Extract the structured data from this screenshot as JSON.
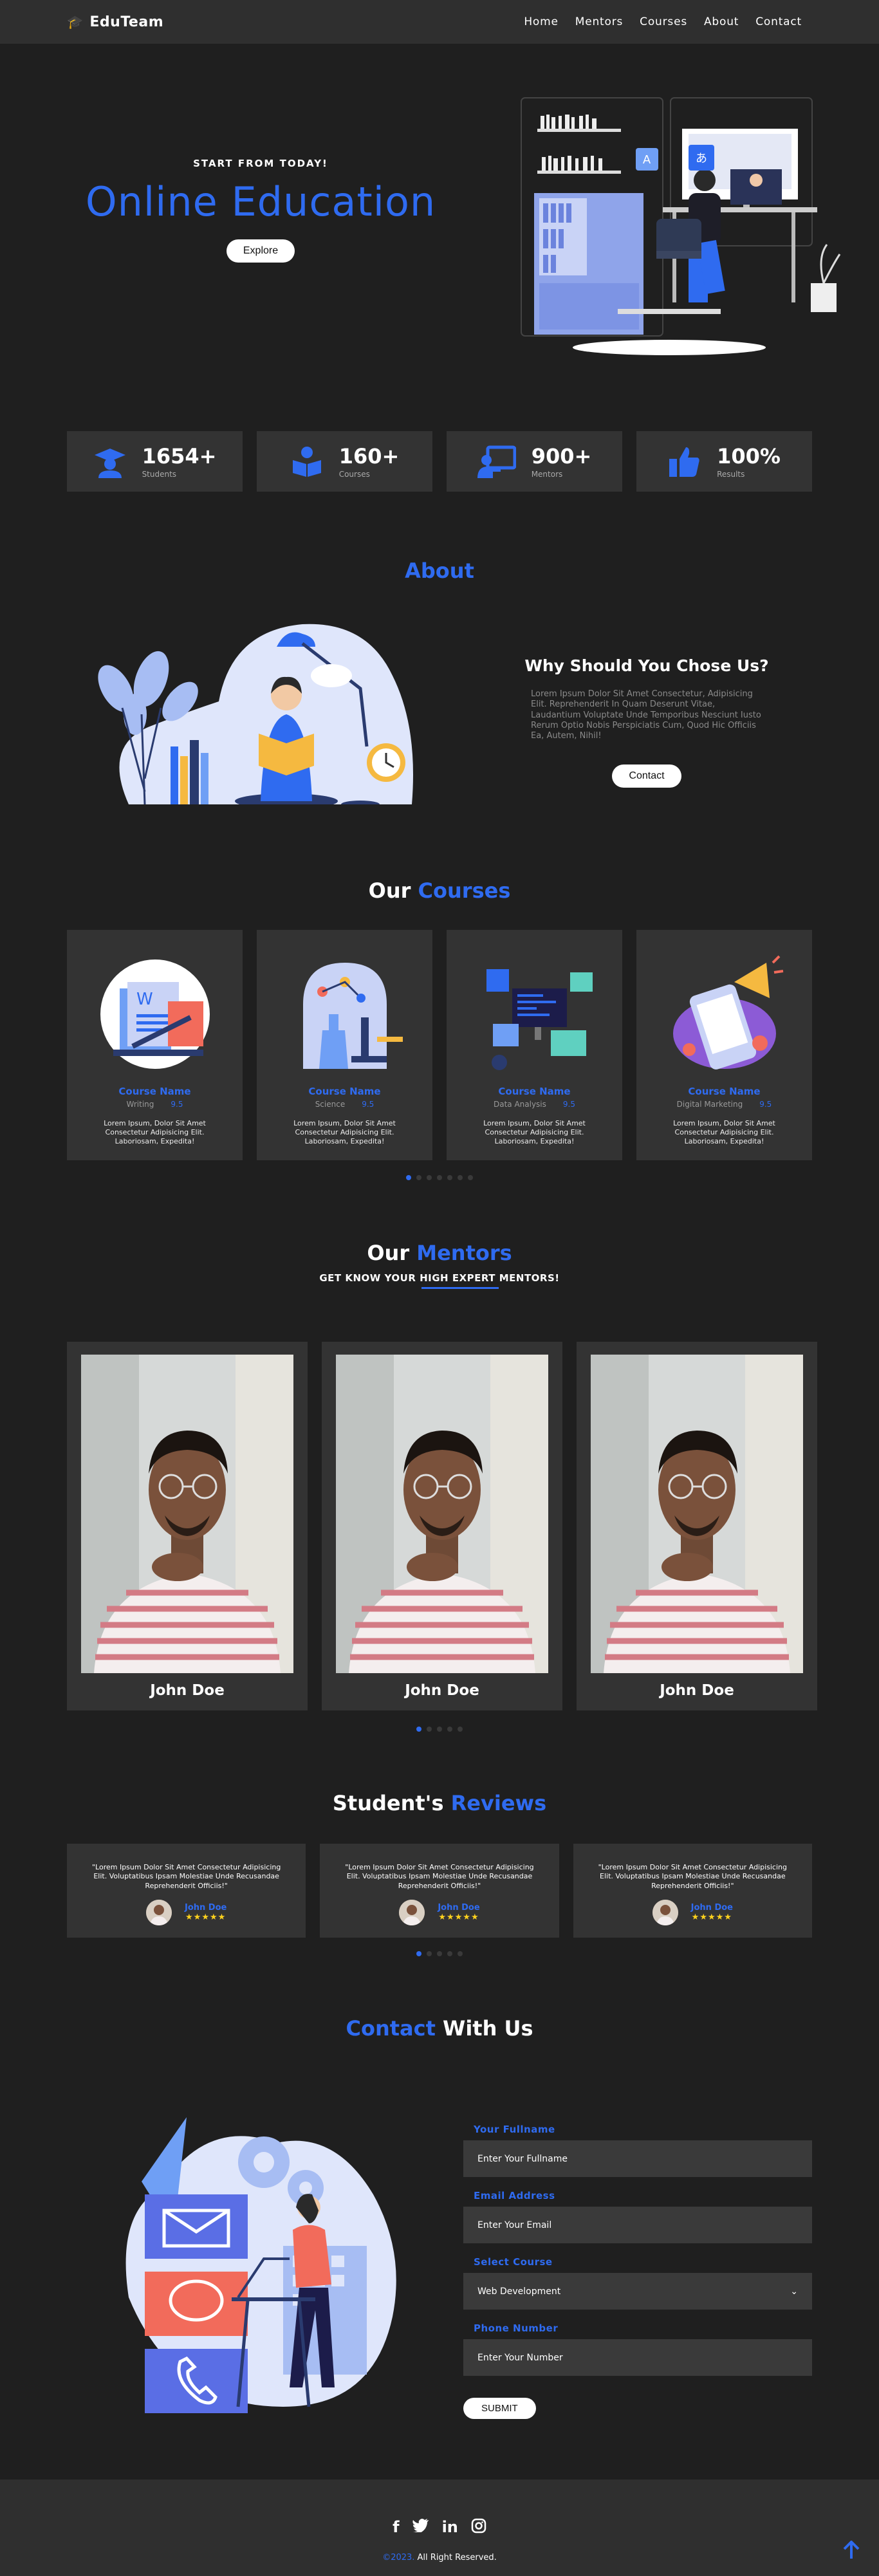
{
  "nav": {
    "brand": "EduTeam",
    "links": [
      "Home",
      "Mentors",
      "Courses",
      "About",
      "Contact"
    ]
  },
  "hero": {
    "kicker": "START FROM TODAY!",
    "title": "Online Education",
    "button": "Explore",
    "bubble_left": "A",
    "bubble_right": "あ"
  },
  "stats": [
    {
      "icon": "graduation-cap-icon",
      "value": "1654+",
      "label": "Students"
    },
    {
      "icon": "book-reader-icon",
      "value": "160+",
      "label": "Courses"
    },
    {
      "icon": "chalkboard-teacher-icon",
      "value": "900+",
      "label": "Mentors"
    },
    {
      "icon": "thumbs-up-icon",
      "value": "100%",
      "label": "Results"
    }
  ],
  "about": {
    "title": "About",
    "heading": "Why Should You Chose Us?",
    "text": "Lorem Ipsum Dolor Sit Amet Consectetur, Adipisicing Elit. Reprehenderit In Quam Deserunt Vitae, Laudantium Voluptate Unde Temporibus Nesciunt Iusto Rerum Optio Nobis Perspiciatis Cum, Quod Hic Officiis Ea, Autem, Nihil!",
    "button": "Contact"
  },
  "courses": {
    "title_plain": "Our",
    "title_accent": "Courses",
    "items": [
      {
        "name": "Course Name",
        "category": "Writing",
        "rating": "9.5",
        "desc": "Lorem Ipsum, Dolor Sit Amet Consectetur Adipisicing Elit. Laboriosam, Expedita!"
      },
      {
        "name": "Course Name",
        "category": "Science",
        "rating": "9.5",
        "desc": "Lorem Ipsum, Dolor Sit Amet Consectetur Adipisicing Elit. Laboriosam, Expedita!"
      },
      {
        "name": "Course Name",
        "category": "Data Analysis",
        "rating": "9.5",
        "desc": "Lorem Ipsum, Dolor Sit Amet Consectetur Adipisicing Elit. Laboriosam, Expedita!"
      },
      {
        "name": "Course Name",
        "category": "Digital Marketing",
        "rating": "9.5",
        "desc": "Lorem Ipsum, Dolor Sit Amet Consectetur Adipisicing Elit. Laboriosam, Expedita!"
      }
    ]
  },
  "mentors": {
    "title_plain": "Our",
    "title_accent": "Mentors",
    "sub_before": "GET KNOW YOUR ",
    "sub_underlined": "HIGH EXPERT",
    "sub_after": " MENTORS!",
    "items": [
      {
        "name": "John Doe"
      },
      {
        "name": "John Doe"
      },
      {
        "name": "John Doe"
      }
    ]
  },
  "reviews": {
    "title_plain": "Student's",
    "title_accent": "Reviews",
    "items": [
      {
        "quote": "\"Lorem Ipsum Dolor Sit Amet Consectetur Adipisicing Elit. Voluptatibus Ipsam Molestiae Unde Recusandae Reprehenderit Officiis!\"",
        "name": "John Doe",
        "stars": "★★★★★"
      },
      {
        "quote": "\"Lorem Ipsum Dolor Sit Amet Consectetur Adipisicing Elit. Voluptatibus Ipsam Molestiae Unde Recusandae Reprehenderit Officiis!\"",
        "name": "John Doe",
        "stars": "★★★★★"
      },
      {
        "quote": "\"Lorem Ipsum Dolor Sit Amet Consectetur Adipisicing Elit. Voluptatibus Ipsam Molestiae Unde Recusandae Reprehenderit Officiis!\"",
        "name": "John Doe",
        "stars": "★★★★★"
      }
    ]
  },
  "contact": {
    "title_accent": "Contact",
    "title_plain": "With Us",
    "fields": [
      {
        "label": "Your Fullname",
        "placeholder": "Enter Your Fullname"
      },
      {
        "label": "Email Address",
        "placeholder": "Enter Your Email"
      },
      {
        "label": "Select Course",
        "placeholder": "Web Development"
      },
      {
        "label": "Phone Number",
        "placeholder": "Enter Your Number"
      }
    ],
    "submit": "SUBMIT"
  },
  "footer": {
    "social": [
      "facebook-icon",
      "twitter-icon",
      "linkedin-icon",
      "instagram-icon"
    ],
    "year": "©2023.",
    "rights": " All Right Reserved."
  },
  "colors": {
    "accent": "#2f6bf0",
    "background": "#1f1f1f",
    "card": "#333333",
    "star": "#ffd21e"
  }
}
